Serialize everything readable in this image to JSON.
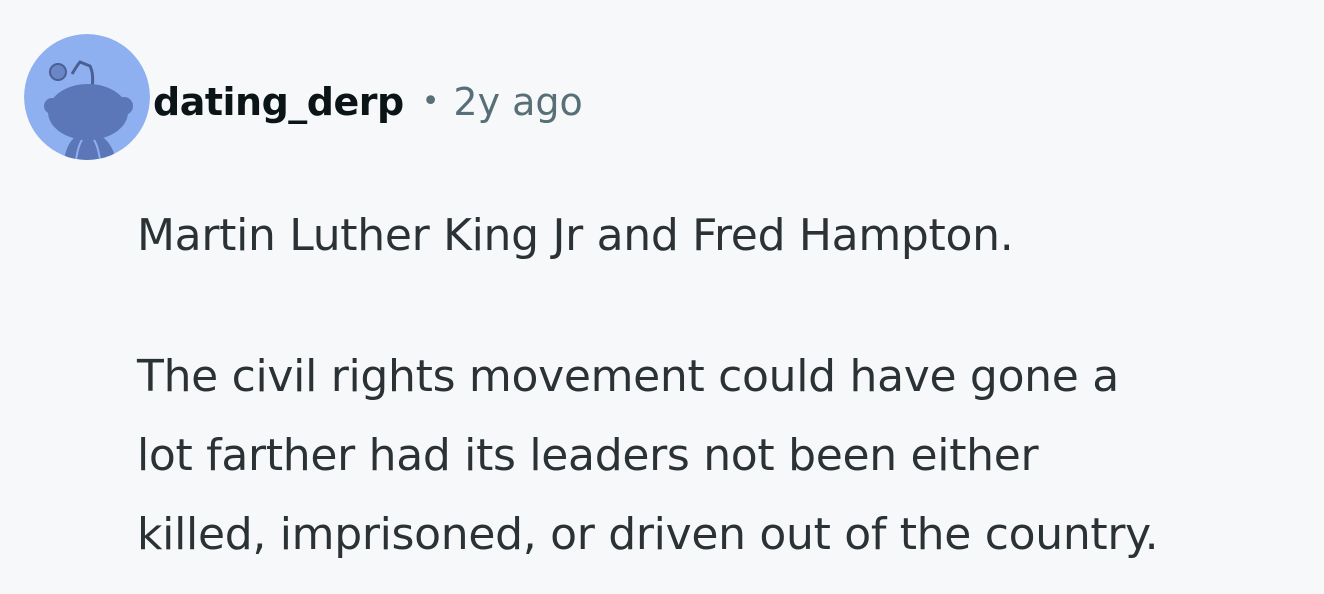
{
  "comment": {
    "username": "dating_derp",
    "separator": "•",
    "timestamp": "2y ago",
    "avatar_icon": "snoo-avatar-icon",
    "avatar_bg_color": "#8fb0f0",
    "avatar_fg_color": "#5b77b7",
    "paragraphs": [
      "Martin Luther King Jr and Fred Hampton.",
      "The civil rights movement could have gone a",
      "lot farther had its leaders not been either",
      "killed, imprisoned, or driven out of the country."
    ]
  }
}
